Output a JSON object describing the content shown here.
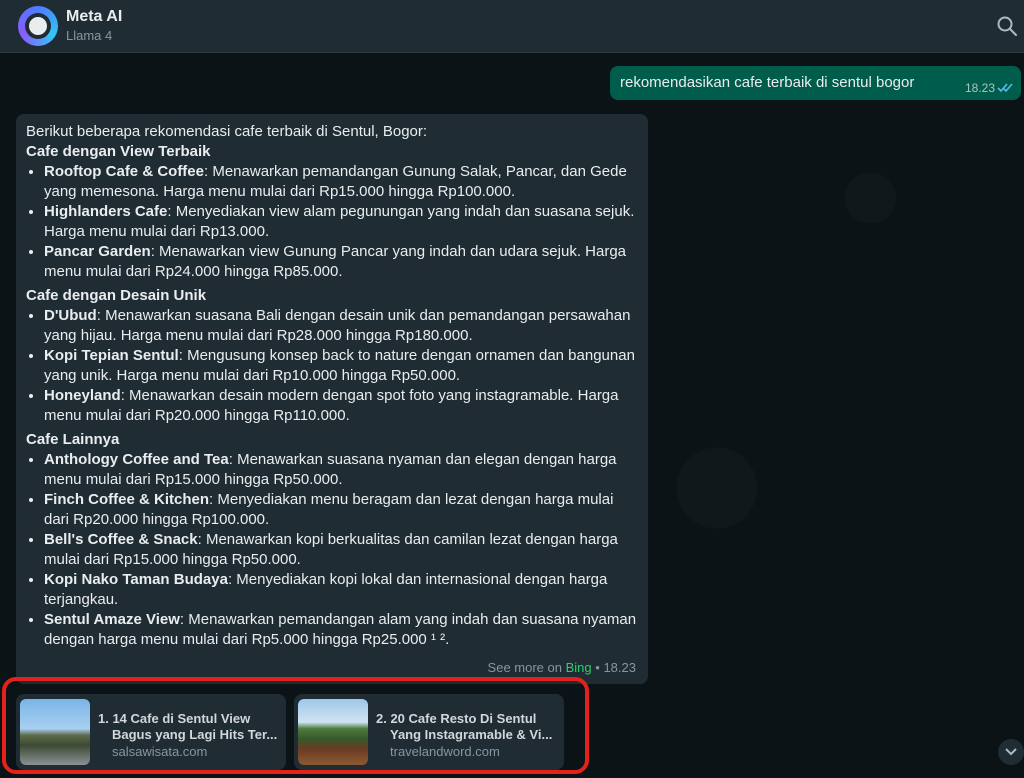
{
  "header": {
    "title": "Meta AI",
    "subtitle": "Llama 4"
  },
  "outgoing": {
    "text": "rekomendasikan cafe terbaik di sentul bogor",
    "time": "18.23"
  },
  "reply": {
    "intro": "Berikut beberapa rekomendasi cafe terbaik di Sentul, Bogor:",
    "sections": [
      {
        "title": "Cafe dengan View Terbaik",
        "items": [
          {
            "name": "Rooftop Cafe & Coffee",
            "desc": ": Menawarkan pemandangan Gunung Salak, Pancar, dan Gede yang memesona. Harga menu mulai dari Rp15.000 hingga Rp100.000."
          },
          {
            "name": "Highlanders Cafe",
            "desc": ": Menyediakan view alam pegunungan yang indah dan suasana sejuk. Harga menu mulai dari Rp13.000."
          },
          {
            "name": "Pancar Garden",
            "desc": ": Menawarkan view Gunung Pancar yang indah dan udara sejuk. Harga menu mulai dari Rp24.000 hingga Rp85.000."
          }
        ]
      },
      {
        "title": "Cafe dengan Desain Unik",
        "items": [
          {
            "name": "D'Ubud",
            "desc": ": Menawarkan suasana Bali dengan desain unik dan pemandangan persawahan yang hijau. Harga menu mulai dari Rp28.000 hingga Rp180.000."
          },
          {
            "name": "Kopi Tepian Sentul",
            "desc": ": Mengusung konsep back to nature dengan ornamen dan bangunan yang unik. Harga menu mulai dari Rp10.000 hingga Rp50.000."
          },
          {
            "name": "Honeyland",
            "desc": ": Menawarkan desain modern dengan spot foto yang instagramable. Harga menu mulai dari Rp20.000 hingga Rp110.000."
          }
        ]
      },
      {
        "title": "Cafe Lainnya",
        "items": [
          {
            "name": "Anthology Coffee and Tea",
            "desc": ": Menawarkan suasana nyaman dan elegan dengan harga menu mulai dari Rp15.000 hingga Rp50.000."
          },
          {
            "name": "Finch Coffee & Kitchen",
            "desc": ": Menyediakan menu beragam dan lezat dengan harga mulai dari Rp20.000 hingga Rp100.000."
          },
          {
            "name": "Bell's Coffee & Snack",
            "desc": ": Menawarkan kopi berkualitas dan camilan lezat dengan harga mulai dari Rp15.000 hingga Rp50.000."
          },
          {
            "name": "Kopi Nako Taman Budaya",
            "desc": ": Menyediakan kopi lokal dan internasional dengan harga terjangkau."
          },
          {
            "name": "Sentul Amaze View",
            "desc": ": Menawarkan pemandangan alam yang indah dan suasana nyaman dengan harga menu mulai dari Rp5.000 hingga Rp25.000 ¹ ²."
          }
        ]
      }
    ],
    "see_more": "See more on",
    "bing": "Bing",
    "separator": "•",
    "time": "18.23"
  },
  "sources": [
    {
      "title_line1": "1. 14 Cafe di Sentul View",
      "title_line2": "Bagus yang Lagi Hits Ter...",
      "domain": "salsawisata.com"
    },
    {
      "title_line1": "2. 20 Cafe Resto Di Sentul",
      "title_line2": "Yang Instagramable & Vi...",
      "domain": "travelandword.com"
    }
  ],
  "colors": {
    "header_bg": "#202c33",
    "outgoing_bubble": "#005c4b",
    "incoming_bubble": "#202c33",
    "highlight": "#e5211c",
    "bing": "#25d366"
  },
  "icons": [
    "search-icon",
    "double-check-icon",
    "chevron-down-icon"
  ]
}
